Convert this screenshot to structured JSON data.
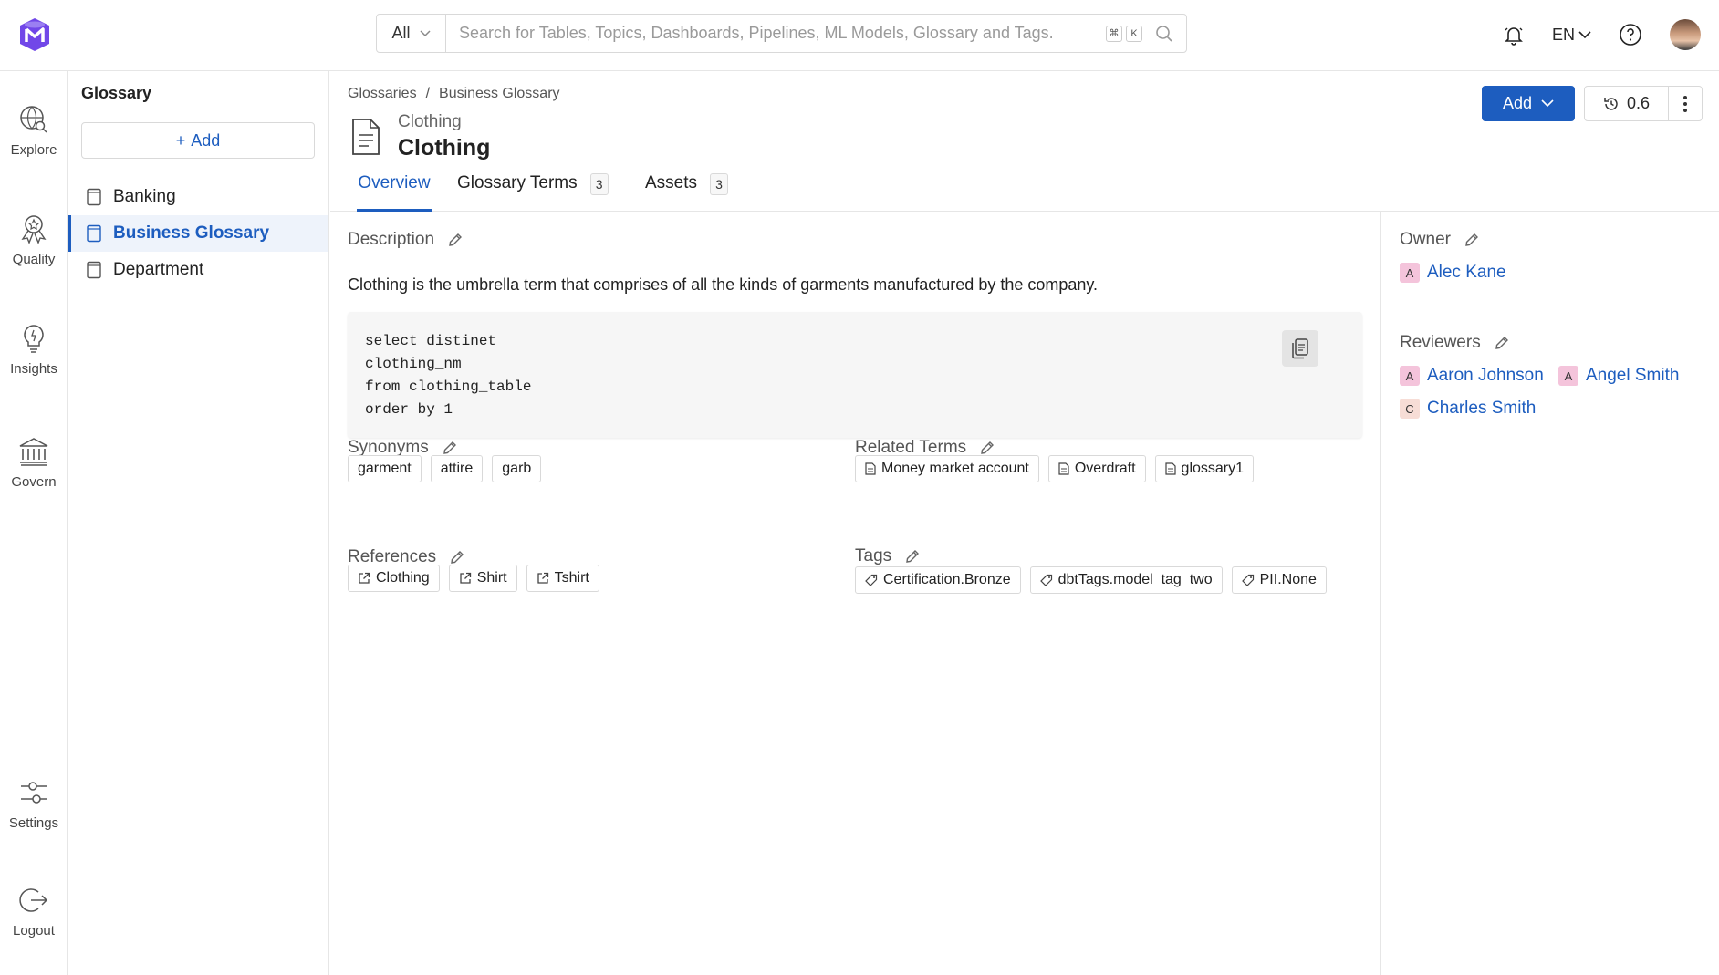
{
  "search": {
    "scope": "All",
    "placeholder": "Search for Tables, Topics, Dashboards, Pipelines, ML Models, Glossary and Tags.",
    "shortcut_cmd": "⌘",
    "shortcut_key": "K"
  },
  "header": {
    "language": "EN"
  },
  "rail": {
    "explore": "Explore",
    "quality": "Quality",
    "insights": "Insights",
    "govern": "Govern",
    "settings": "Settings",
    "logout": "Logout"
  },
  "glossary_panel": {
    "title": "Glossary",
    "add_label": "Add",
    "items": [
      {
        "label": "Banking"
      },
      {
        "label": "Business Glossary"
      },
      {
        "label": "Department"
      }
    ]
  },
  "breadcrumb": {
    "first": "Glossaries",
    "separator": "/",
    "second": "Business Glossary"
  },
  "entity": {
    "subtitle": "Clothing",
    "title": "Clothing"
  },
  "actions": {
    "add_label": "Add",
    "version": "0.6"
  },
  "tabs": [
    {
      "label": "Overview"
    },
    {
      "label": "Glossary Terms",
      "count": "3"
    },
    {
      "label": "Assets",
      "count": "3"
    }
  ],
  "description": {
    "label": "Description",
    "text": "Clothing is the umbrella term that comprises of all the kinds of garments manufactured by the company.",
    "code": "select distinet\nclothing_nm\nfrom clothing_table\norder by 1"
  },
  "synonyms": {
    "label": "Synonyms",
    "items": [
      "garment",
      "attire",
      "garb"
    ]
  },
  "related_terms": {
    "label": "Related Terms",
    "items": [
      "Money market account",
      "Overdraft",
      "glossary1"
    ]
  },
  "references": {
    "label": "References",
    "items": [
      "Clothing",
      "Shirt",
      "Tshirt"
    ]
  },
  "tags": {
    "label": "Tags",
    "items": [
      "Certification.Bronze",
      "dbtTags.model_tag_two",
      "PII.None"
    ]
  },
  "owner": {
    "label": "Owner",
    "name": "Alec Kane",
    "initial": "A"
  },
  "reviewers": {
    "label": "Reviewers",
    "people": [
      {
        "name": "Aaron Johnson",
        "initial": "A"
      },
      {
        "name": "Angel Smith",
        "initial": "A"
      },
      {
        "name": "Charles Smith",
        "initial": "C"
      }
    ]
  },
  "colors": {
    "accent": "#1d5dbf",
    "badge_pink": "#f4c4db",
    "badge_peach": "#f7ddd6"
  }
}
